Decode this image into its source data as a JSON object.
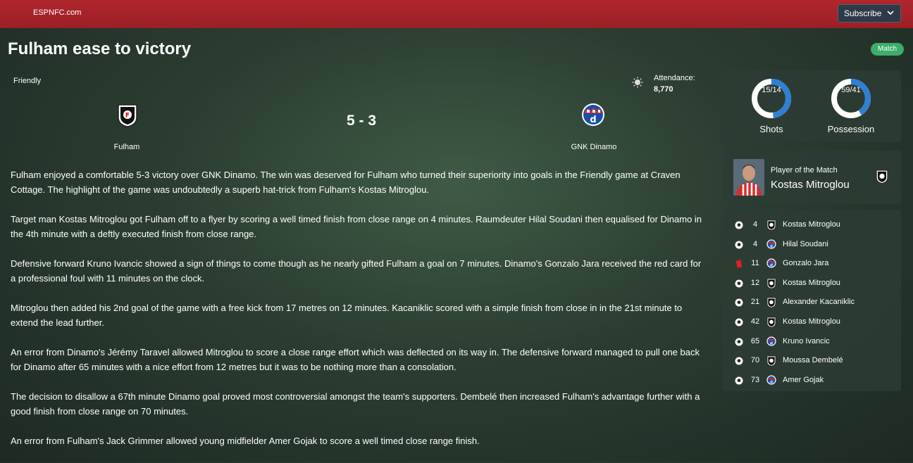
{
  "header": {
    "brand": "ESPNFC.com",
    "subscribe_label": "Subscribe"
  },
  "article": {
    "headline": "Fulham ease to victory",
    "badge": "Match"
  },
  "match": {
    "competition": "Friendly",
    "attendance_label": "Attendance:",
    "attendance_value": "8,770",
    "home_team": "Fulham",
    "away_team": "GNK Dinamo",
    "score": "5 - 3"
  },
  "report": {
    "paragraphs": [
      "Fulham enjoyed a comfortable 5-3 victory over GNK Dinamo. The win was deserved for Fulham who turned their superiority into goals in the Friendly game at Craven Cottage. The highlight of the game was undoubtedly a superb hat-trick from Fulham's Kostas Mitroglou.",
      "Target man Kostas Mitroglou got Fulham off to a flyer by scoring a well timed finish from close range on 4 minutes. Raumdeuter Hilal Soudani then equalised for Dinamo in the 4th minute with a deftly executed finish from close range.",
      "Defensive forward Kruno Ivancic showed a sign of things to come though as he nearly gifted Fulham a goal on 7 minutes. Dinamo's Gonzalo Jara received the red card for a professional foul with 11 minutes on the clock.",
      "Mitroglou then added his 2nd goal of the game with a free kick from 17 metres on 12 minutes. Kacaniklic scored with a simple finish from close in in the 21st minute to extend the lead further.",
      "An error from Dinamo's Jérémy Taravel allowed Mitroglou to score a close range effort which was deflected on its way in. The defensive forward managed to pull one back for Dinamo after 65 minutes with a nice effort from 12 metres but it was to be nothing more than a consolation.",
      "The decision to disallow a 67th minute Dinamo goal proved most controversial amongst the team's supporters. Dembelé then increased Fulham's advantage further with a good finish from close range on 70 minutes.",
      "An error from Fulham's Jack Grimmer allowed young midfielder Amer Gojak to score a well timed close range finish."
    ]
  },
  "stats": {
    "shots": {
      "label": "Shots",
      "value_text": "15/14",
      "home": 15,
      "away": 14
    },
    "possession": {
      "label": "Possession",
      "value_text": "59/41",
      "home": 59,
      "away": 41
    },
    "home_color": "#ffffff",
    "away_color": "#2f7fd6"
  },
  "potm": {
    "label": "Player of the Match",
    "name": "Kostas Mitroglou"
  },
  "events": [
    {
      "minute": "4",
      "type": "goal",
      "team": "home",
      "player": "Kostas Mitroglou"
    },
    {
      "minute": "4",
      "type": "goal",
      "team": "away",
      "player": "Hilal Soudani"
    },
    {
      "minute": "11",
      "type": "red-card",
      "team": "away",
      "player": "Gonzalo Jara"
    },
    {
      "minute": "12",
      "type": "goal",
      "team": "home",
      "player": "Kostas Mitroglou"
    },
    {
      "minute": "21",
      "type": "goal",
      "team": "home",
      "player": "Alexander Kacaniklic"
    },
    {
      "minute": "42",
      "type": "goal",
      "team": "home",
      "player": "Kostas Mitroglou"
    },
    {
      "minute": "65",
      "type": "goal",
      "team": "away",
      "player": "Kruno Ivancic"
    },
    {
      "minute": "70",
      "type": "goal",
      "team": "home",
      "player": "Moussa Dembelé"
    },
    {
      "minute": "73",
      "type": "goal",
      "team": "away",
      "player": "Amer Gojak"
    }
  ]
}
